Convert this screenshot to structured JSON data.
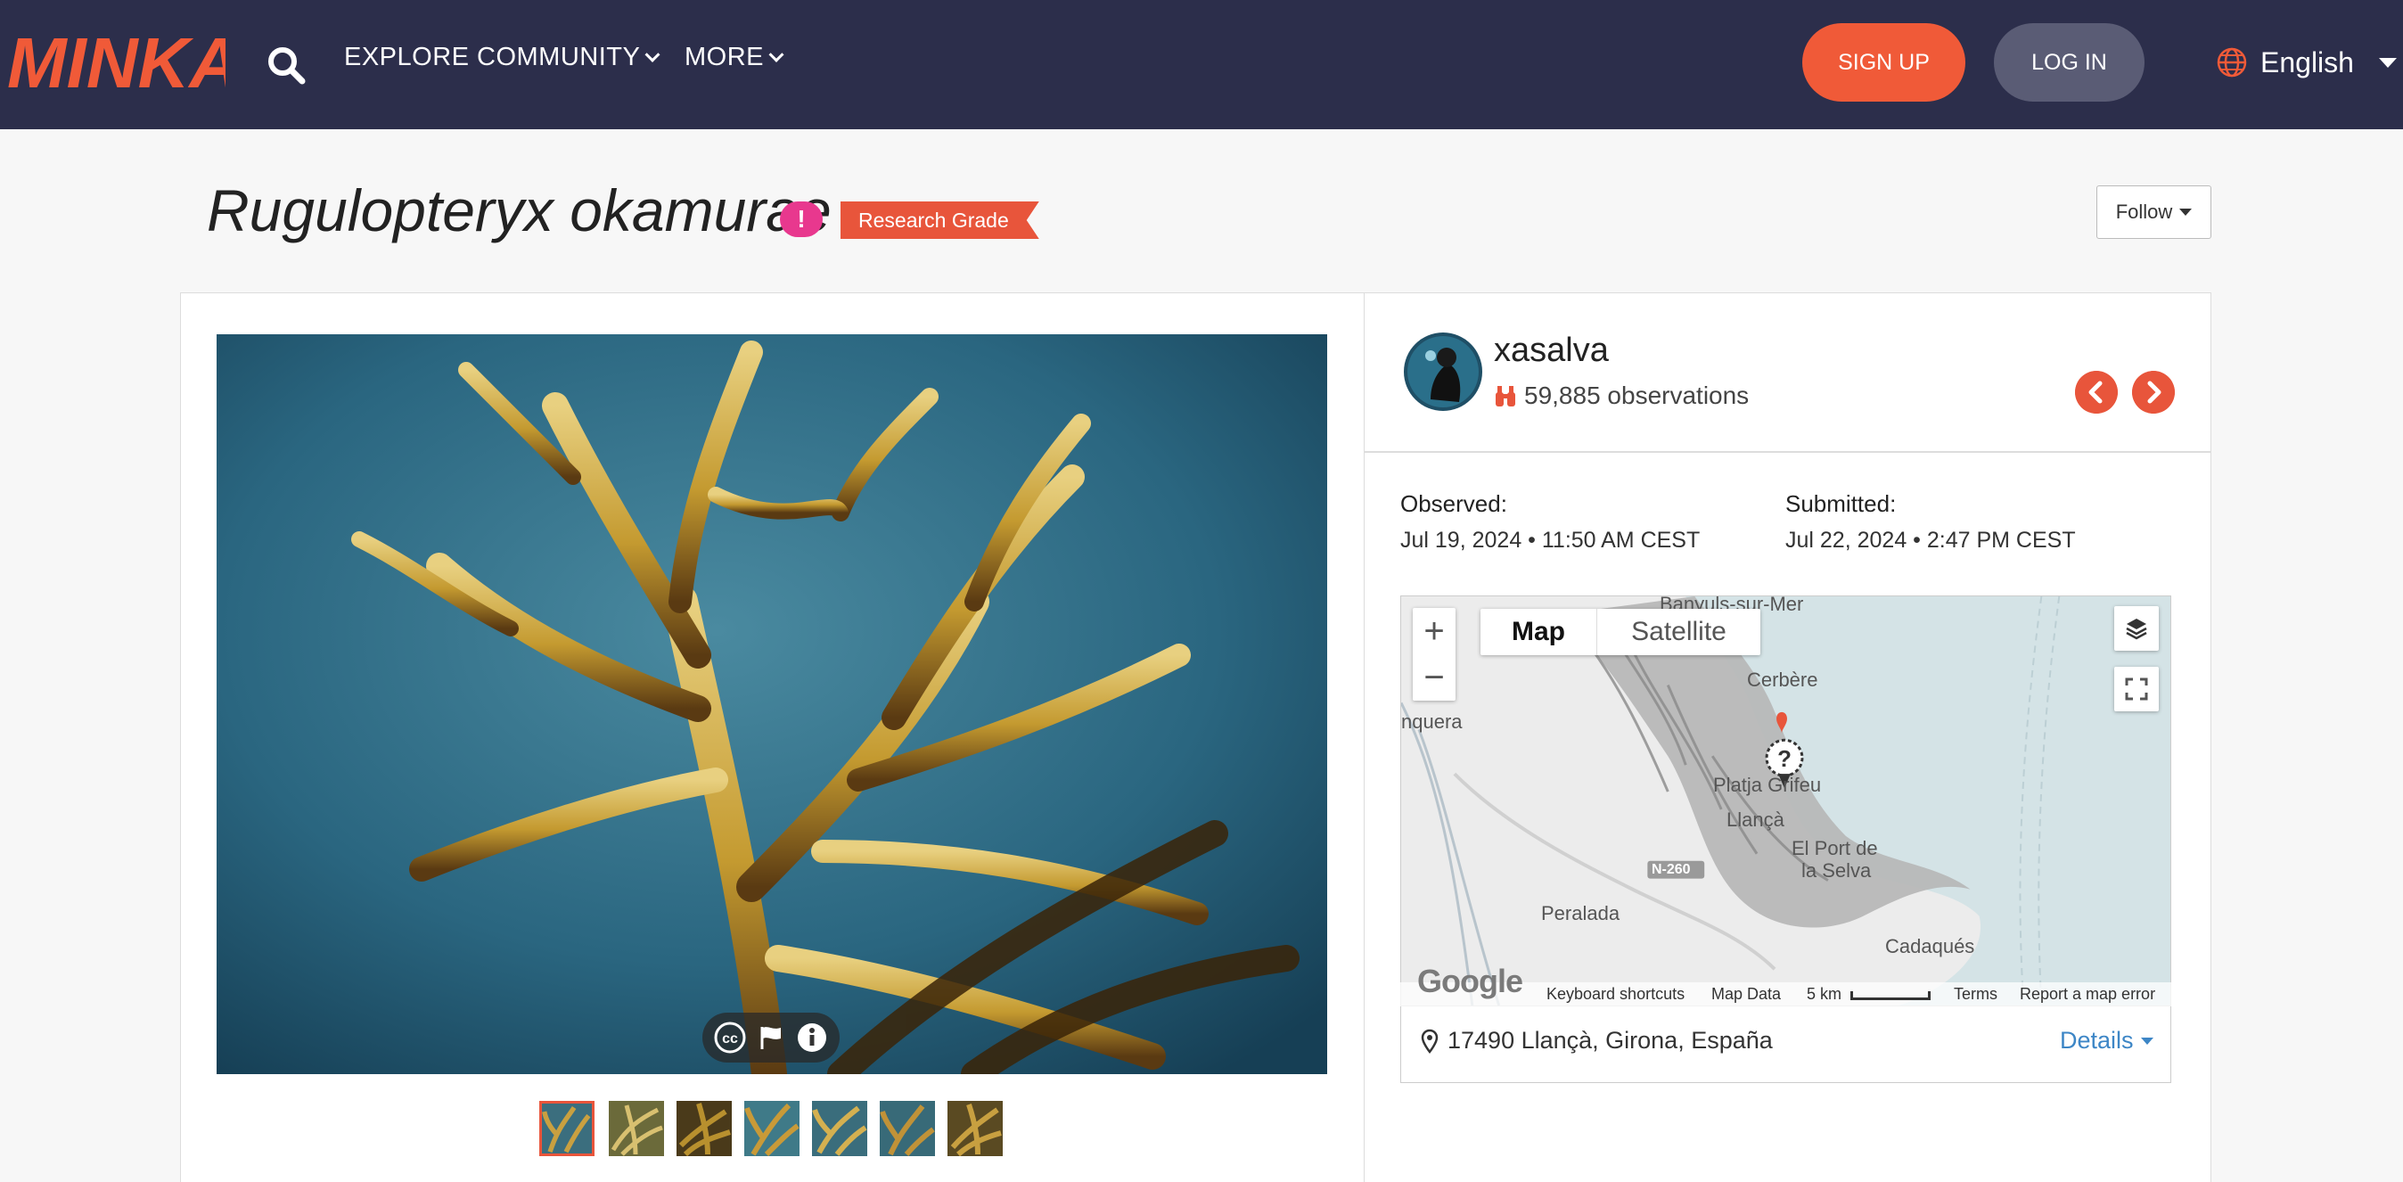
{
  "nav": {
    "logo": "MINKA",
    "search_icon": "search-icon",
    "links": [
      "EXPLORE",
      "COMMUNITY",
      "MORE"
    ],
    "signup": "SIGN UP",
    "login": "LOG IN",
    "language": "English"
  },
  "observation": {
    "taxon": "Rugulopteryx okamurae",
    "warning_badge": "!",
    "quality_grade": "Research Grade",
    "follow_label": "Follow"
  },
  "observer": {
    "username": "xasalva",
    "observations_count": "59,885 observations"
  },
  "dates": {
    "observed_label": "Observed:",
    "observed_value": "Jul 19, 2024 • 11:50 AM CEST",
    "submitted_label": "Submitted:",
    "submitted_value": "Jul 22, 2024 • 2:47 PM CEST"
  },
  "map": {
    "tabs": [
      "Map",
      "Satellite"
    ],
    "labels": [
      "Banyuls-sur-Mer",
      "Cerbère",
      "nquera",
      "Platja Grifeu",
      "Llançà",
      "El Port de",
      "la Selva",
      "N-260",
      "Peralada",
      "Cadaqués"
    ],
    "footer": {
      "shortcuts": "Keyboard shortcuts",
      "data": "Map Data",
      "scale": "5 km",
      "terms": "Terms",
      "report": "Report a map error"
    },
    "google_label": "Google",
    "location": "17490 Llançà, Girona, España",
    "details_label": "Details"
  },
  "photo": {
    "thumbnail_count": 7,
    "active_thumbnail": 0
  },
  "colors": {
    "nav_bg": "#2c2e4b",
    "accent": "#e8553b",
    "signup": "#f05a38",
    "warning": "#e8388e",
    "link": "#3d86c6"
  }
}
